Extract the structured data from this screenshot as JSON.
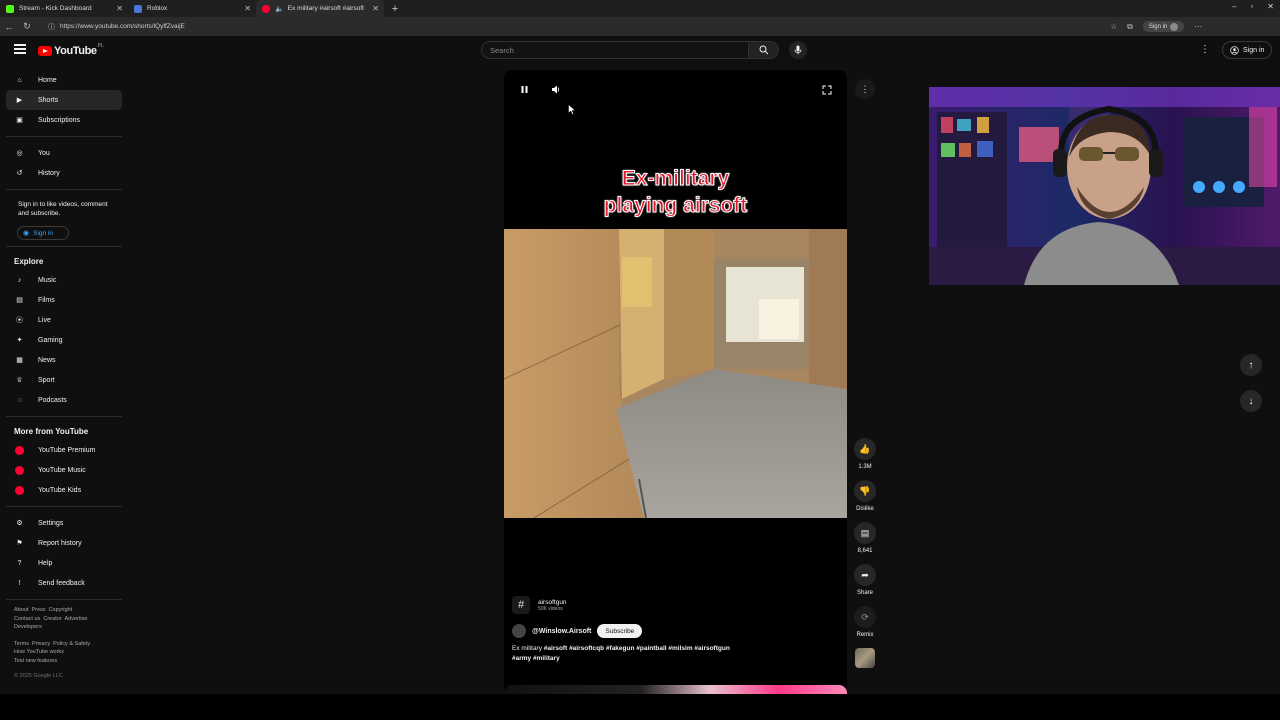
{
  "browser": {
    "tabs": [
      {
        "title": "Stream - Kick Dashboard",
        "favicon_color": "#53fc18"
      },
      {
        "title": "Roblox",
        "favicon_color": "#4a78d6"
      },
      {
        "title": "Ex military #airsoft #airsoft",
        "favicon_color": "#ff0033"
      }
    ],
    "url": "https://www.youtube.com/shorts/lQyffZvaijE",
    "profile_chip": "Sign in"
  },
  "masthead": {
    "logo_text": "YouTube",
    "country": "PL",
    "search_placeholder": "Search",
    "signin": "Sign in"
  },
  "sidebar": {
    "primary": [
      {
        "label": "Home",
        "icon": "home-icon"
      },
      {
        "label": "Shorts",
        "icon": "shorts-icon",
        "active": true
      },
      {
        "label": "Subscriptions",
        "icon": "subscriptions-icon"
      }
    ],
    "you": [
      {
        "label": "You",
        "icon": "user-icon"
      },
      {
        "label": "History",
        "icon": "history-icon"
      }
    ],
    "signin_prompt": "Sign in to like videos, comment and subscribe.",
    "signin_button": "Sign in",
    "explore_title": "Explore",
    "explore": [
      {
        "label": "Music",
        "icon": "music-icon"
      },
      {
        "label": "Films",
        "icon": "films-icon"
      },
      {
        "label": "Live",
        "icon": "live-icon"
      },
      {
        "label": "Gaming",
        "icon": "gaming-icon"
      },
      {
        "label": "News",
        "icon": "news-icon"
      },
      {
        "label": "Sport",
        "icon": "trophy-icon"
      },
      {
        "label": "Podcasts",
        "icon": "podcast-icon"
      }
    ],
    "more_title": "More from YouTube",
    "more": [
      {
        "label": "YouTube Premium"
      },
      {
        "label": "YouTube Music"
      },
      {
        "label": "YouTube Kids"
      }
    ],
    "settings": [
      {
        "label": "Settings",
        "icon": "gear-icon"
      },
      {
        "label": "Report history",
        "icon": "flag-icon"
      },
      {
        "label": "Help",
        "icon": "help-icon"
      },
      {
        "label": "Send feedback",
        "icon": "feedback-icon"
      }
    ],
    "footer1": [
      "About",
      "Press",
      "Copyright",
      "Contact us",
      "Creator",
      "Advertise",
      "Developers"
    ],
    "footer2": [
      "Terms",
      "Privacy",
      "Policy & Safety",
      "How YouTube works",
      "Test new features"
    ],
    "copyright": "© 2025 Google LLC"
  },
  "short": {
    "caption_line1": "Ex-military",
    "caption_line2": "playing airsoft",
    "tag": "airsoftgun",
    "tag_count": "50K videos",
    "channel": "@Winslow.Airsoft",
    "subscribe": "Subscribe",
    "desc_plain": "Ex military ",
    "desc_tags_1": "#airsoft #airsoftcqb #fakegun #paintball #milsim #airsoftgun",
    "desc_tags_2": "#army #military"
  },
  "actions": {
    "likes": "1.3M",
    "dislike": "Dislike",
    "comments": "8,641",
    "share": "Share",
    "remix": "Remix"
  }
}
